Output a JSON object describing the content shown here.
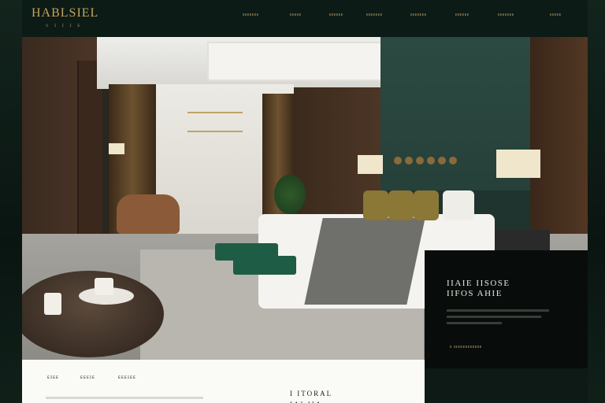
{
  "header": {
    "logo": "HABLSIEL",
    "logo_sub": "ᴜ ɪ ɪ ɪ ᴇ",
    "nav": [
      "ᴇᴇᴇᴇᴇᴇᴇ",
      "ᴇᴇᴇᴇᴇ",
      "ᴇᴇᴇᴇᴇᴇ",
      "ᴇᴇᴇᴇᴇᴇᴇ",
      "ᴇᴇᴇᴇᴇᴇᴇ",
      "ᴇᴇᴇᴇᴇᴇ",
      "ᴇᴇᴇᴇᴇᴇᴇ",
      "ᴇᴇᴇᴇᴇ"
    ]
  },
  "feature_panel": {
    "title": "IIAIE IISOSE\nIIFOS AHIE",
    "link": "ᴇ ɪᴇᴇᴇᴇᴇᴇᴇᴇᴇᴇᴇ"
  },
  "footer": {
    "tabs": [
      "ᴇɪᴇᴇ",
      "ᴇᴇᴇɪᴇ",
      "ᴇᴇᴇɪᴇᴇ"
    ],
    "title": "I ITORAL\nIAI IIA"
  },
  "colors": {
    "accent_gold": "#c9a35a",
    "dark_green": "#0c1b16",
    "wall_green": "#2c4a42",
    "bench_green": "#1f5c45"
  }
}
